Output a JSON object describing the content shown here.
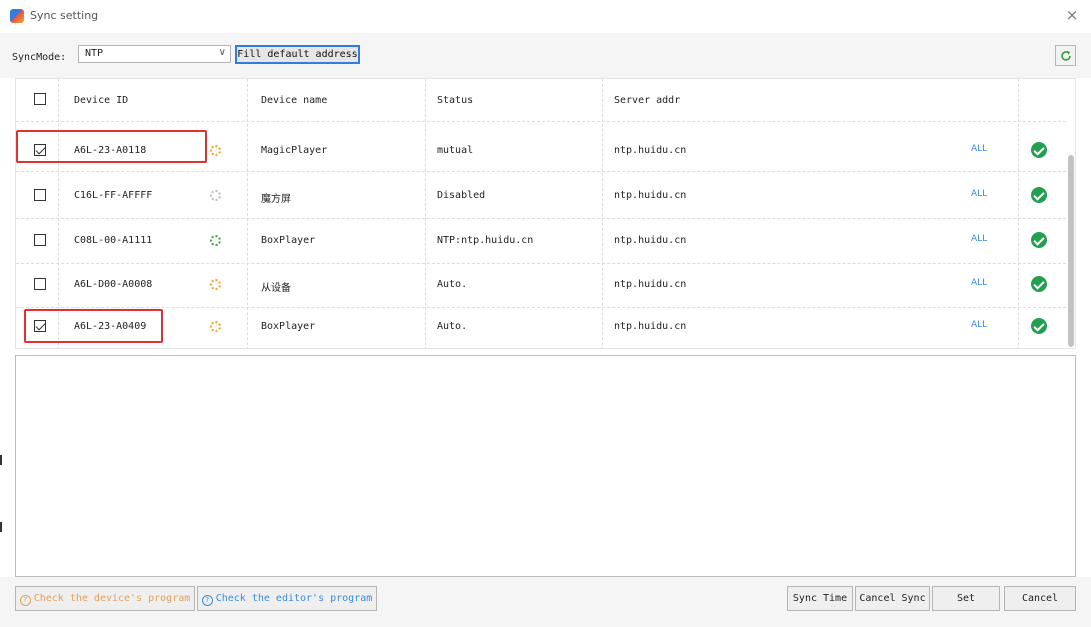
{
  "window": {
    "title": "Sync setting",
    "close_glyph": "×"
  },
  "toolbar": {
    "mode_label": "SyncMode:",
    "mode_value": "NTP",
    "fill_default_label": "Fill default address",
    "refresh_icon": "refresh-icon"
  },
  "table": {
    "headers": {
      "device_id": "Device ID",
      "device_name": "Device name",
      "status": "Status",
      "server_addr": "Server addr"
    },
    "rows": [
      {
        "checked": true,
        "device_id": "A6L-23-A0118",
        "ring_color": "#f0a030",
        "device_name": "MagicPlayer",
        "status": "mutual",
        "server_addr": "ntp.huidu.cn",
        "all_label": "ALL"
      },
      {
        "checked": false,
        "device_id": "C16L-FF-AFFFF",
        "ring_color": "#bbbbbb",
        "device_name": "魔方屏",
        "status": "Disabled",
        "server_addr": "ntp.huidu.cn",
        "all_label": "ALL"
      },
      {
        "checked": false,
        "device_id": "C08L-00-A1111",
        "ring_color": "#3aa83a",
        "device_name": "BoxPlayer",
        "status": "NTP:ntp.huidu.cn",
        "server_addr": "ntp.huidu.cn",
        "all_label": "ALL"
      },
      {
        "checked": false,
        "device_id": "A6L-D00-A0008",
        "ring_color": "#f0a030",
        "device_name": "从设备",
        "status": "Auto.",
        "server_addr": "ntp.huidu.cn",
        "all_label": "ALL"
      },
      {
        "checked": true,
        "device_id": "A6L-23-A0409",
        "ring_color": "#f0a030",
        "device_name": "BoxPlayer",
        "status": "Auto.",
        "server_addr": "ntp.huidu.cn",
        "all_label": "ALL"
      }
    ]
  },
  "bottom": {
    "check_device_program": "Check the device's program",
    "check_editor_program": "Check the editor's program",
    "sync_time": "Sync Time",
    "cancel_sync": "Cancel Sync",
    "set": "Set",
    "cancel": "Cancel"
  },
  "colors": {
    "accent": "#2f7de1",
    "link": "#3d8bd9",
    "ok": "#22a050",
    "highlight": "#e03030",
    "warning_text": "#e2a060"
  }
}
